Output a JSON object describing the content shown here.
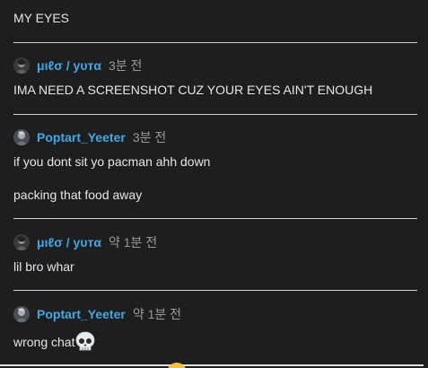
{
  "messages": [
    {
      "body": "MY EYES"
    },
    {
      "username": "μιℓσ / уυтα",
      "timestamp": "3분 전",
      "body": "IMA NEED A SCREENSHOT CUZ YOUR EYES AIN'T ENOUGH"
    },
    {
      "username": "Poptart_Yeeter",
      "timestamp": "3분 전",
      "body": "if you dont sit yo pacman ahh down",
      "body2": "packing that food away"
    },
    {
      "username": "μιℓσ / уυтα",
      "timestamp": "약 1분 전",
      "body": "lil bro whar"
    },
    {
      "username": "Poptart_Yeeter",
      "timestamp": "약 1분 전",
      "body": "wrong chat",
      "emoji": "skull-icon"
    }
  ],
  "colors": {
    "background": "#1e1e1e",
    "username": "#3fa9e8",
    "timestamp": "#9a9a9a",
    "text": "#e6e6e6",
    "divider": "#cfcfcf"
  }
}
